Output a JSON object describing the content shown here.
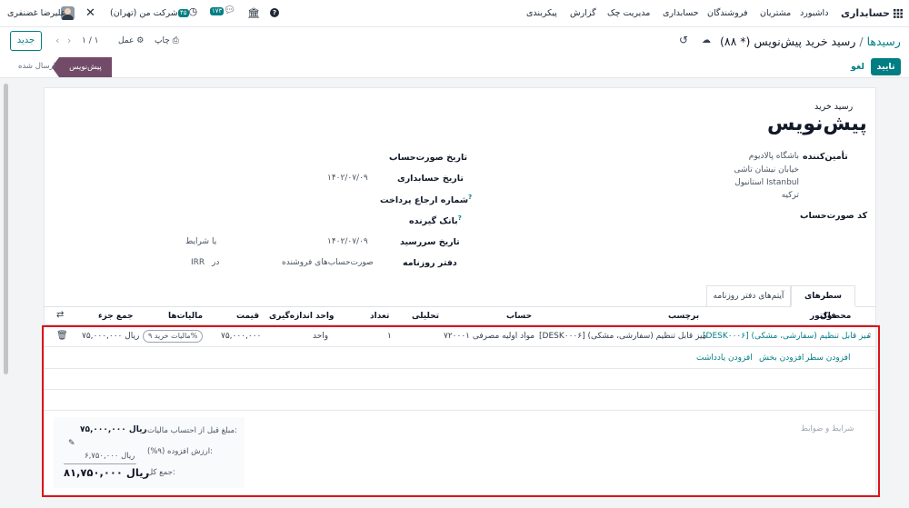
{
  "navbar": {
    "brand": "حسابداری",
    "menu": [
      "داشبورد",
      "مشتریان",
      "فروشندگان",
      "حسابداری",
      "مدیریت چک",
      "گزارش",
      "پیکربندی"
    ],
    "user_name": "علیرضا غضنفری",
    "company": "شرکت من (تهران)",
    "chat_count": "۱۷۳",
    "activity_count": "۴۵"
  },
  "control": {
    "new_label": "جدید",
    "pager": "۱ / ۱",
    "action_label": "عمل",
    "print_label": "چاپ",
    "breadcrumb_parent": "رسیدها",
    "breadcrumb_current": "رسید خرید پیش‌نویس (* ۸۸)"
  },
  "status": {
    "confirm_label": "تایید",
    "cancel_label": "لغو",
    "stage_draft": "پیش‌نویس",
    "stage_sent": "ارسال شده"
  },
  "form": {
    "doc_type": "رسید خرید",
    "title": "پیش‌نویس",
    "vendor_label": "تأمین‌کننده",
    "vendor_address": [
      "باشگاه پالادیوم",
      "خیابان نیشان تاشی",
      "استانبول Istanbul",
      "ترکیه"
    ],
    "bill_ref_label": "کد صورت‌حساب",
    "invoice_date_label": "تاریخ صورت‌حساب",
    "accounting_date_label": "تاریخ حسابداری",
    "accounting_date": "۱۴۰۲/۰۷/۰۹",
    "payment_ref_label": "شماره ارجاع پرداخت",
    "bank_label": "بانک گیرنده",
    "due_date_label": "تاریخ سررسید",
    "due_date": "۱۴۰۲/۰۷/۰۹",
    "or_text": "یا",
    "terms_text": "شرایط",
    "journal_label": "دفتر روزنامه",
    "journal": "صورت‌حساب‌های فروشنده",
    "in_text": "در",
    "currency": "IRR"
  },
  "tabs": [
    "سطرهای فاکتور",
    "آیتم‌های دفتر روزنامه"
  ],
  "table": {
    "headers": [
      "محصول",
      "برچسب",
      "حساب",
      "تحلیلی",
      "تعداد",
      "واحد اندازه‌گیری",
      "قیمت",
      "مالیات‌ها",
      "جمع جزء"
    ],
    "row": {
      "product": "[DESK۰۰۰۶] میز قابل تنظیم (سفارشی، مشکی)",
      "label": "[DESK۰۰۰۶] میز قابل تنظیم (سفارشی، مشکی)",
      "account": "۷۲۰۰۰۱ مواد اولیه مصرفی",
      "quantity": "۱",
      "uom": "واحد",
      "price": "۷۵,۰۰۰,۰۰۰",
      "tax": "مالیات خرید ۹%",
      "subtotal": "۷۵,۰۰۰,۰۰۰ ریال"
    },
    "add_line": "افزودن سطر",
    "add_section": "افزودن بخش",
    "add_note": "افزودن یادداشت"
  },
  "totals": {
    "terms_placeholder": "شرایط و ضوابط",
    "untaxed_label": "مبلغ قبل از احتساب مالیات:",
    "untaxed_value": "ریال ۷۵,۰۰۰,۰۰۰",
    "vat_label": "ارزش افزوده (۹%):",
    "vat_value": "ریال ۶,۷۵۰,۰۰۰",
    "total_label": "جمع کل:",
    "total_value": "ریال ۸۱,۷۵۰,۰۰۰"
  },
  "colors": {
    "accent": "#017e84",
    "stage": "#714b67",
    "highlight": "#e0131a"
  }
}
